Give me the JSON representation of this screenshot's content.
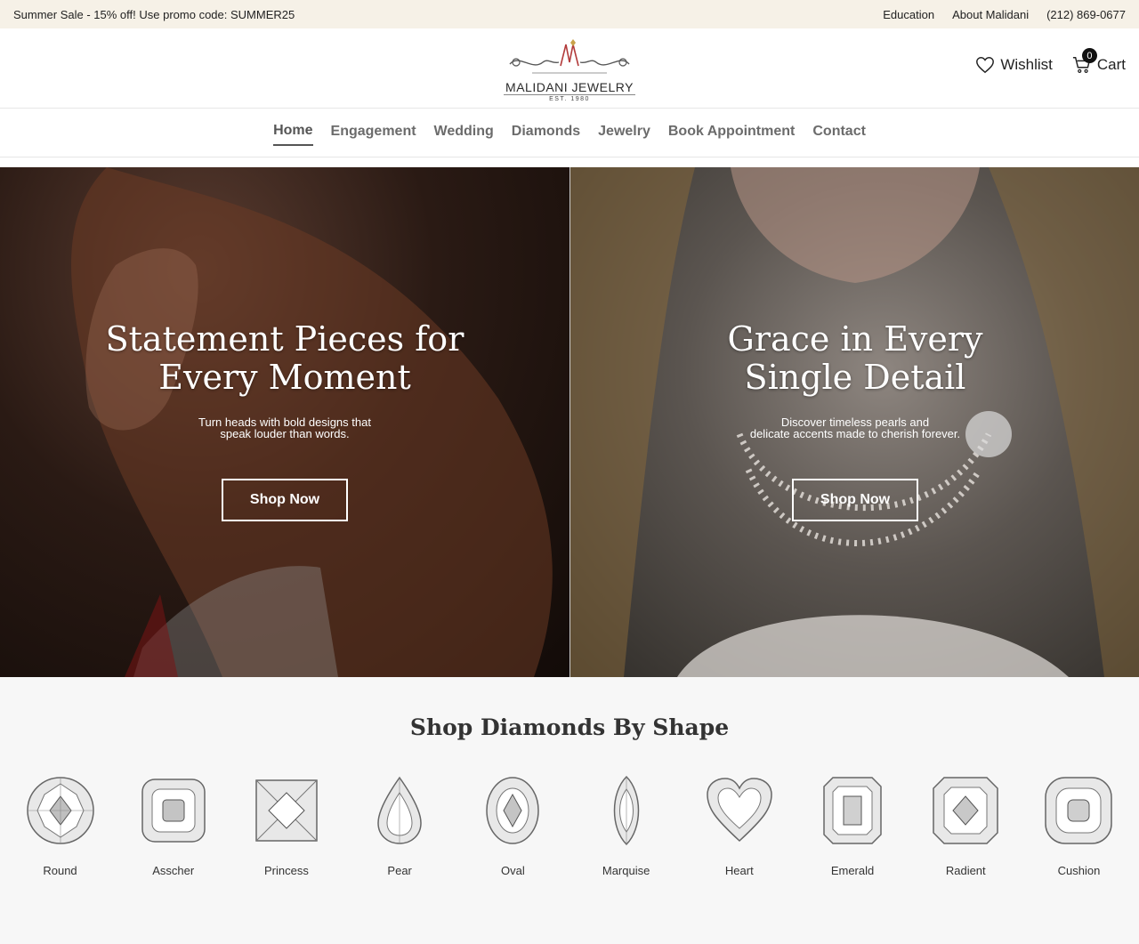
{
  "promo": {
    "text": "Summer Sale - 15% off! Use promo code: SUMMER25",
    "links": [
      "Education",
      "About Malidani",
      "(212) 869-0677"
    ]
  },
  "header": {
    "logo_text": "MALIDANI JEWELRY",
    "logo_est": "EST. 1980",
    "wishlist_label": "Wishlist",
    "cart_label": "Cart",
    "cart_count": "0"
  },
  "nav": {
    "items": [
      "Home",
      "Engagement",
      "Wedding",
      "Diamonds",
      "Jewelry",
      "Book Appointment",
      "Contact"
    ],
    "active": "Home"
  },
  "hero": [
    {
      "title_line1": "Statement Pieces for",
      "title_line2": "Every Moment",
      "sub_line1": "Turn heads with bold designs that",
      "sub_line2": "speak louder than words.",
      "button": "Shop Now"
    },
    {
      "title_line1": "Grace in Every",
      "title_line2": "Single Detail",
      "sub_line1": "Discover timeless pearls and",
      "sub_line2": "delicate accents made to cherish forever.",
      "button": "Shop Now"
    }
  ],
  "shapes": {
    "title": "Shop Diamonds By Shape",
    "items": [
      "Round",
      "Asscher",
      "Princess",
      "Pear",
      "Oval",
      "Marquise",
      "Heart",
      "Emerald",
      "Radient",
      "Cushion"
    ]
  },
  "colors": {
    "promo_bg": "#f6f1e7",
    "section_bg": "#f7f7f7",
    "nav_text": "#6b6b6b"
  }
}
